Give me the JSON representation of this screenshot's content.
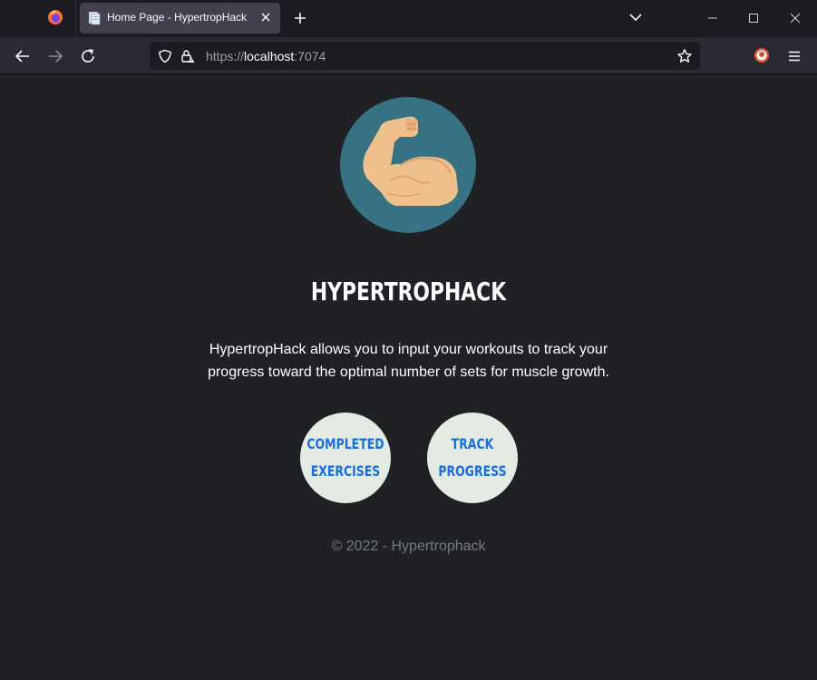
{
  "browser": {
    "tab": {
      "title": "Home Page - HypertropHack"
    },
    "url": {
      "scheme": "https://",
      "host": "localhost",
      "port": ":7074"
    }
  },
  "page": {
    "title": "HYPERTROPHACK",
    "description": "HypertropHack allows you to input your workouts to track your progress toward the optimal number of sets for muscle growth.",
    "buttons": [
      {
        "line1": "COMPLETED",
        "line2": "EXERCISES"
      },
      {
        "line1": "TRACK",
        "line2": "PROGRESS"
      }
    ],
    "footer": "© 2022 - Hypertrophack"
  },
  "colors": {
    "page_bg": "#202124",
    "logo_circle": "#367283",
    "arm": "#f0c08c",
    "button_bg": "#e3ebe3",
    "button_text": "#1a6fe0"
  }
}
